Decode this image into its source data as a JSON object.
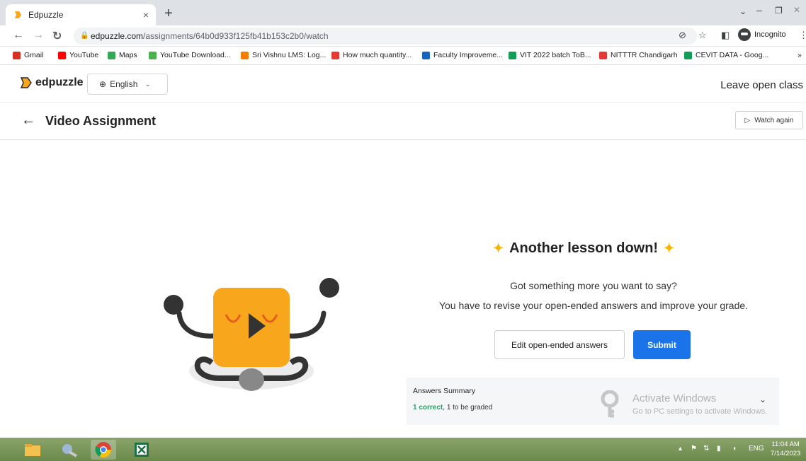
{
  "browser": {
    "tab_title": "Edpuzzle",
    "tab_close": "×",
    "new_tab": "+",
    "url_host": "edpuzzle.com",
    "url_path": "/assignments/64b0d933f125fb41b153c2b0/watch",
    "incognito_label": "Incognito"
  },
  "bookmarks": [
    {
      "label": "Gmail",
      "color": "#d93025"
    },
    {
      "label": "YouTube",
      "color": "#ff0000"
    },
    {
      "label": "Maps",
      "color": "#34a853"
    },
    {
      "label": "YouTube Download...",
      "color": "#4caf50"
    },
    {
      "label": "Sri Vishnu LMS: Log...",
      "color": "#f57c00"
    },
    {
      "label": "How much quantity...",
      "color": "#e53935"
    },
    {
      "label": "Faculty Improveme...",
      "color": "#1565c0"
    },
    {
      "label": "VIT 2022 batch ToB...",
      "color": "#0f9d58"
    },
    {
      "label": "NITTTR Chandigarh",
      "color": "#e53935"
    },
    {
      "label": "CEVIT DATA - Goog...",
      "color": "#0f9d58"
    }
  ],
  "header": {
    "logo_text": "edpuzzle",
    "language": "English",
    "leave_class": "Leave open class"
  },
  "titlebar": {
    "title": "Video Assignment",
    "watch_again": "Watch again"
  },
  "main": {
    "headline": "Another lesson down!",
    "line1": "Got something more you want to say?",
    "line2": "You have to revise your open-ended answers and improve your grade.",
    "edit_button": "Edit open-ended answers",
    "submit_button": "Submit"
  },
  "summary": {
    "title": "Answers Summary",
    "correct": "1 correct",
    "separator": ", ",
    "graded": "1 to be graded"
  },
  "watermark": {
    "line1": "Activate Windows",
    "line2": "Go to PC settings to activate Windows."
  },
  "taskbar": {
    "lang": "ENG",
    "time": "11:04 AM",
    "date": "7/14/2023"
  },
  "colors": {
    "accent": "#1a73e8",
    "sparkle": "#f6b300",
    "mascot": "#f8a61c",
    "correct": "#2e9e63"
  }
}
